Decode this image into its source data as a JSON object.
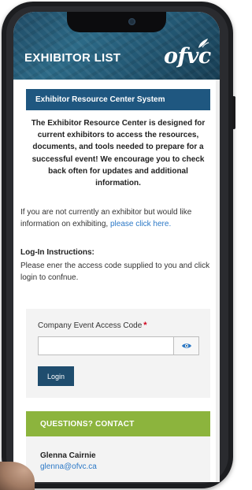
{
  "header": {
    "title": "EXHIBITOR LIST",
    "logo_text": "ofvc"
  },
  "banner": {
    "title": "Exhibitor Resource Center System"
  },
  "intro": {
    "text": "The Exhibitor Resource Center is designed for current exhibitors to access the resources, documents, and tools needed to prepare for a successful event! We encourage you to check back often for updates and additional information."
  },
  "notice": {
    "text": "If you are not currently an exhibitor but would like information on exhibiting,",
    "link_text": "please click here."
  },
  "login_instructions": {
    "heading": "Log-In Instructions:",
    "text": "Please ener the access code supplied to you and click login to confnue."
  },
  "form": {
    "field_label": "Company Event Access Code",
    "required_marker": "*",
    "input_value": "",
    "login_label": "Login"
  },
  "contact": {
    "header": "QUESTIONS? CONTACT",
    "name": "Glenna Cairnie",
    "email": "glenna@ofvc.ca"
  },
  "icons": {
    "eye": "eye-icon",
    "logo_leaf": "leaf-icon",
    "camera": "camera-icon"
  },
  "colors": {
    "header_bg": "#245a76",
    "banner_bg": "#1f5780",
    "login_button_bg": "#1f4d6e",
    "contact_header_bg": "#8cb43d",
    "link": "#2b78c6",
    "required": "#d0021b"
  }
}
